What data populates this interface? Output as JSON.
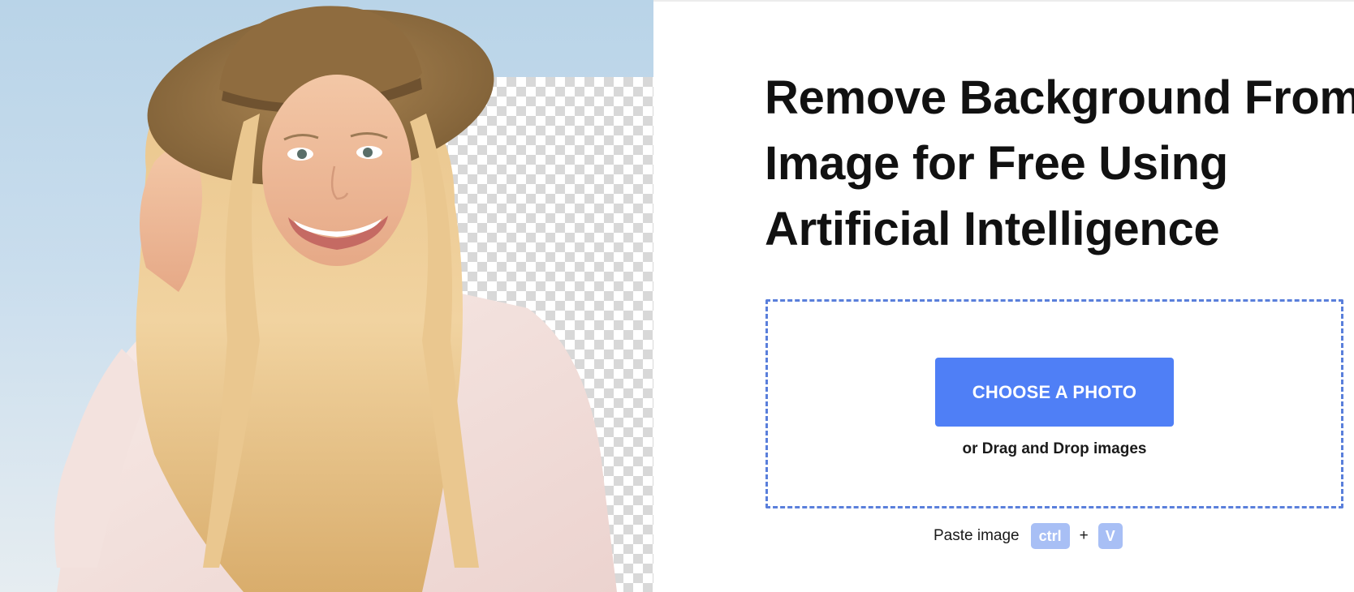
{
  "hero": {
    "image_alt": "Smiling woman with long blonde hair wearing a straw hat, background partially removed showing transparency grid"
  },
  "headline": {
    "line1": "Remove Background From",
    "line2": "Image for Free Using",
    "line3": "Artificial Intelligence"
  },
  "upload": {
    "choose_label": "CHOOSE A PHOTO",
    "drag_text": "or Drag and Drop images"
  },
  "paste": {
    "label": "Paste image",
    "key1": "ctrl",
    "plus": "+",
    "key2": "V"
  },
  "colors": {
    "accent": "#4f7ff6",
    "dashed_border": "#5a7fdb",
    "kbd_bg": "#a8bff5",
    "headline": "#111111"
  }
}
